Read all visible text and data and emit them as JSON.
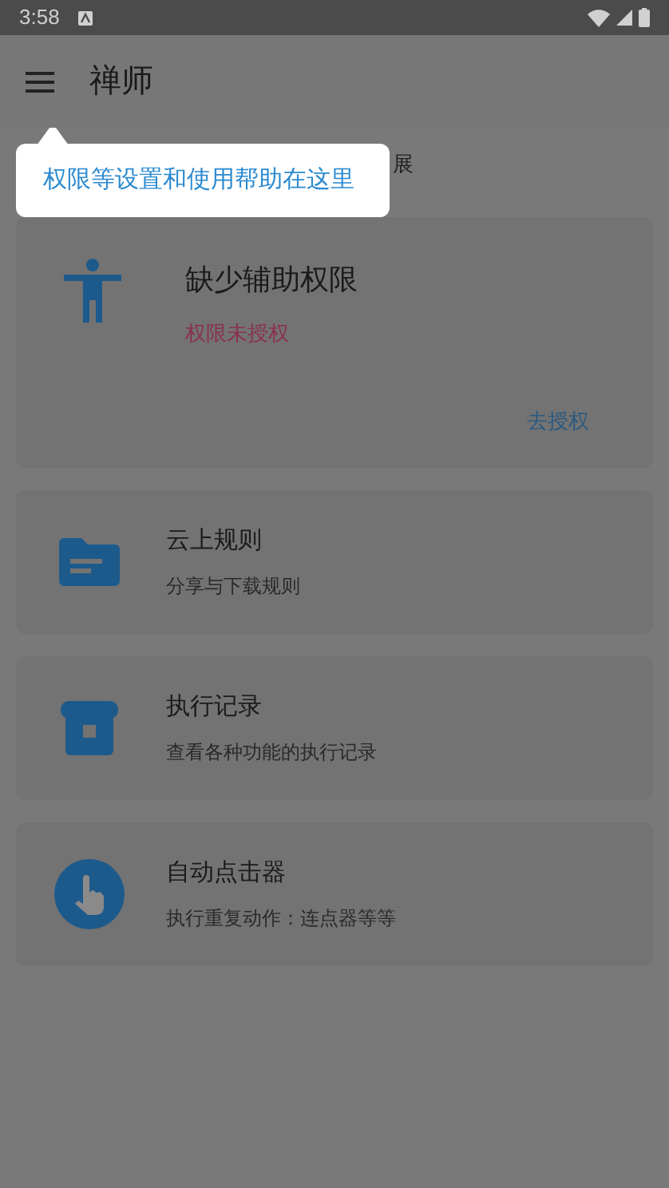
{
  "status_bar": {
    "time": "3:58"
  },
  "app_bar": {
    "title": "禅师"
  },
  "tooltip": {
    "text": "权限等设置和使用帮助在这里"
  },
  "partial_text": "展",
  "permission_card": {
    "title": "缺少辅助权限",
    "status": "权限未授权",
    "action": "去授权"
  },
  "cards": [
    {
      "kind": "folder",
      "title": "云上规则",
      "subtitle": "分享与下载规则"
    },
    {
      "kind": "archive",
      "title": "执行记录",
      "subtitle": "查看各种功能的执行记录"
    },
    {
      "kind": "touch",
      "title": "自动点击器",
      "subtitle": "执行重复动作：连点器等等"
    }
  ]
}
